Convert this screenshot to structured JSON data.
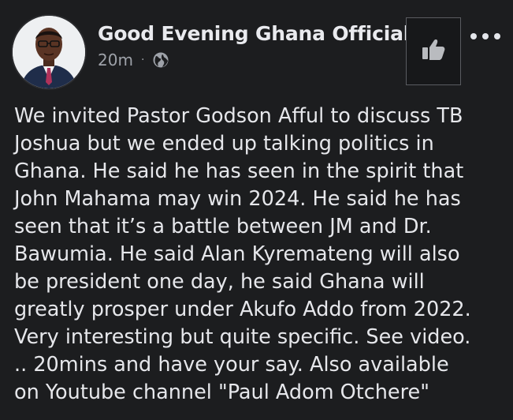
{
  "post": {
    "page_name": "Good Evening Ghana Official",
    "timestamp": "20m",
    "separator": "·",
    "privacy_icon": "globe-icon",
    "like_icon": "thumbs-up-icon",
    "more_icon": "more-options-icon",
    "text_lines": [
      "We invited Pastor Godson Afful to discuss TB",
      "Joshua but we ended up talking politics in",
      "Ghana. He said he has seen in the spirit that",
      "John Mahama may win 2024. He said he has",
      "seen that it’s a battle between JM and Dr.",
      "Bawumia. He said Alan Kyremateng will also",
      "be president one day, he said Ghana will",
      "greatly prosper under Akufo Addo from 2022.",
      "Very interesting but quite specific. See video.",
      ".. 20mins and have your say. Also available",
      "on Youtube channel \"Paul Adom Otchere\""
    ]
  },
  "colors": {
    "background": "#1c1d1f",
    "text": "#e6e7eb",
    "meta_text": "#9ea2a9"
  }
}
